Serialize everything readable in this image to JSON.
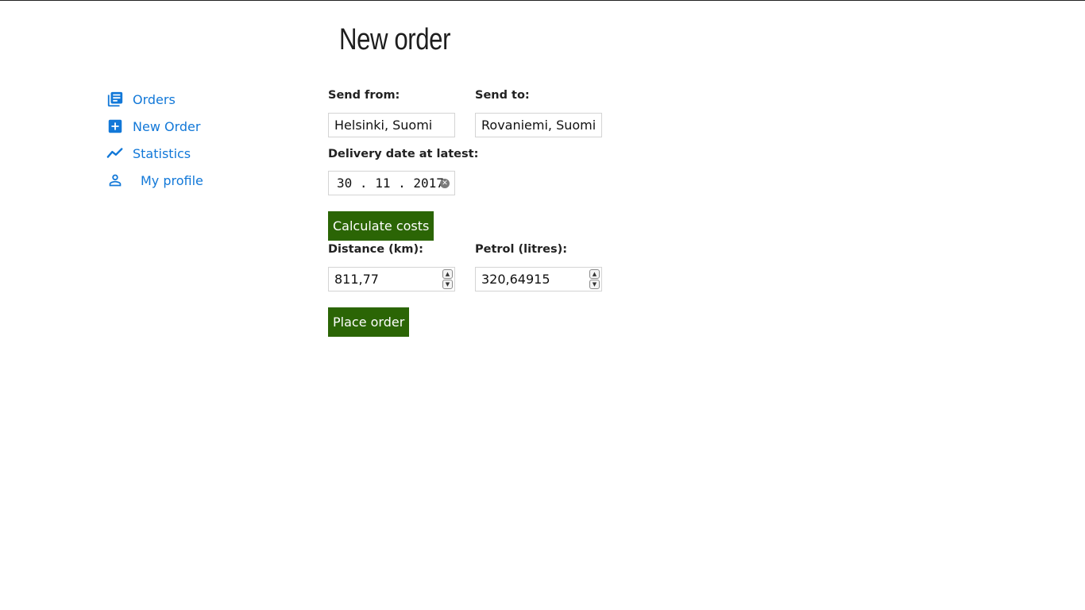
{
  "page": {
    "title": "New order"
  },
  "sidebar": {
    "items": [
      {
        "label": "Orders",
        "icon": "library-books-icon"
      },
      {
        "label": "New Order",
        "icon": "add-box-icon"
      },
      {
        "label": "Statistics",
        "icon": "trending-line-icon"
      },
      {
        "label": "My profile",
        "icon": "person-icon"
      }
    ],
    "link_color": "#1278d8"
  },
  "form": {
    "send_from": {
      "label": "Send from:",
      "value": "Helsinki, Suomi"
    },
    "send_to": {
      "label": "Send to:",
      "value": "Rovaniemi, Suomi"
    },
    "delivery_date": {
      "label": "Delivery date at latest:",
      "day": "30",
      "month": "11",
      "year": "2017",
      "sep": "."
    },
    "calculate_label": "Calculate costs",
    "distance": {
      "label": "Distance (km):",
      "value": "811,77"
    },
    "petrol": {
      "label": "Petrol (litres):",
      "value": "320,64915"
    },
    "place_order_label": "Place order",
    "button_color": "#2b6505"
  }
}
